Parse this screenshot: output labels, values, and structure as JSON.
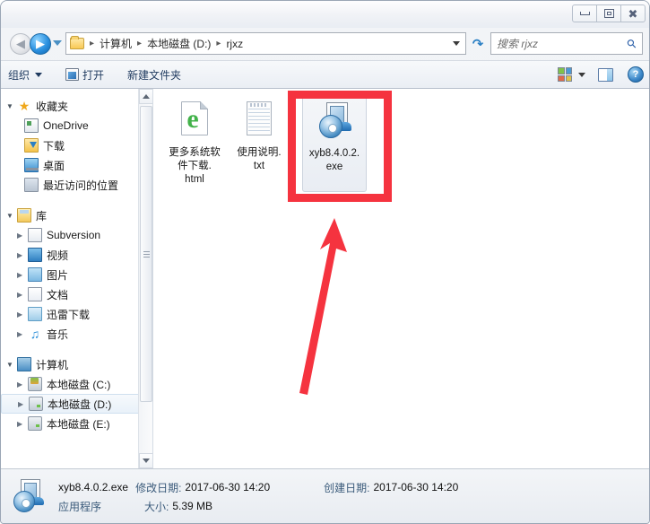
{
  "window": {
    "title": "",
    "controls": {
      "minimize": "最小化",
      "maximize": "最大化",
      "close": "关闭"
    }
  },
  "address_bar": {
    "back_label": "后退",
    "forward_label": "前进",
    "history_label": "最近的位置",
    "refresh_label": "刷新",
    "crumbs": [
      "计算机",
      "本地磁盘 (D:)",
      "rjxz"
    ],
    "separator": "▸",
    "dropdown_label": "以前的位置"
  },
  "search": {
    "placeholder": "搜索 rjxz",
    "icon": "search-icon"
  },
  "toolbar": {
    "organize_label": "组织",
    "open_label": "打开",
    "new_folder_label": "新建文件夹",
    "view_label": "更改您的视图",
    "preview_label": "显示预览窗格",
    "help_label": "获取帮助"
  },
  "sidebar": {
    "groups": [
      {
        "label": "收藏夹",
        "icon": "star-icon",
        "expanded": true,
        "items": [
          {
            "label": "OneDrive",
            "icon": "onedrive-icon"
          },
          {
            "label": "下载",
            "icon": "downloads-icon"
          },
          {
            "label": "桌面",
            "icon": "desktop-icon"
          },
          {
            "label": "最近访问的位置",
            "icon": "recent-places-icon"
          }
        ]
      },
      {
        "label": "库",
        "icon": "library-icon",
        "expanded": true,
        "items": [
          {
            "label": "Subversion",
            "icon": "subversion-icon"
          },
          {
            "label": "视频",
            "icon": "video-icon"
          },
          {
            "label": "图片",
            "icon": "pictures-icon"
          },
          {
            "label": "文档",
            "icon": "documents-icon"
          },
          {
            "label": "迅雷下载",
            "icon": "xunlei-icon"
          },
          {
            "label": "音乐",
            "icon": "music-icon"
          }
        ]
      },
      {
        "label": "计算机",
        "icon": "computer-icon",
        "expanded": true,
        "items": [
          {
            "label": "本地磁盘 (C:)",
            "icon": "system-drive-icon"
          },
          {
            "label": "本地磁盘 (D:)",
            "icon": "drive-icon",
            "selected": true
          },
          {
            "label": "本地磁盘 (E:)",
            "icon": "drive-icon"
          }
        ]
      }
    ]
  },
  "files": [
    {
      "name": "更多系统软件下载.html",
      "lines": [
        "更多系统软",
        "件下载.",
        "html"
      ],
      "icon": "html-file-icon",
      "selected": false
    },
    {
      "name": "使用说明.txt",
      "lines": [
        "使用说明.",
        "txt"
      ],
      "icon": "text-file-icon",
      "selected": false
    },
    {
      "name": "xyb8.4.0.2.exe",
      "lines": [
        "xyb8.4.0.2.",
        "exe"
      ],
      "icon": "exe-file-icon",
      "selected": true
    }
  ],
  "annotation": {
    "highlight_color": "#f5333f",
    "arrow_color": "#f5333f",
    "target": "xyb8.4.0.2.exe"
  },
  "status": {
    "file_name": "xyb8.4.0.2.exe",
    "file_type": "应用程序",
    "modified_label": "修改日期:",
    "modified_value": "2017-06-30 14:20",
    "created_label": "创建日期:",
    "created_value": "2017-06-30 14:20",
    "size_label": "大小:",
    "size_value": "5.39 MB"
  }
}
